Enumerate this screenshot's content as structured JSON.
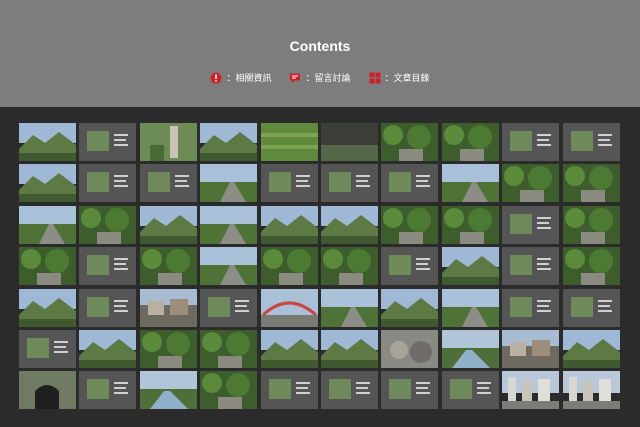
{
  "header": {
    "title": "Contents",
    "legend": [
      {
        "icon": "info-alert-icon",
        "label": "：相關資訊",
        "color": "#d11f26"
      },
      {
        "icon": "comment-icon",
        "label": "：留言討論",
        "color": "#d11f26"
      },
      {
        "icon": "grid-menu-icon",
        "label": "：文章目錄",
        "color": "#d11f26"
      }
    ]
  },
  "gallery": {
    "rows": 7,
    "cols": 10,
    "thumbs": [
      [
        "mountain",
        "doc",
        "tower",
        "mountain",
        "green",
        "dark",
        "forest",
        "forest",
        "doc",
        "doc"
      ],
      [
        "mountain",
        "doc",
        "doc",
        "road",
        "doc",
        "doc",
        "doc",
        "road",
        "forest",
        "forest"
      ],
      [
        "road",
        "forest",
        "mountain",
        "road",
        "mountain",
        "mountain",
        "forest",
        "forest",
        "doc",
        "forest"
      ],
      [
        "forest",
        "doc",
        "forest",
        "road",
        "forest",
        "forest",
        "doc",
        "mountain",
        "doc",
        "forest"
      ],
      [
        "mountain",
        "doc",
        "village",
        "doc",
        "bridge",
        "road",
        "mountain",
        "road",
        "doc",
        "doc"
      ],
      [
        "doc",
        "mountain",
        "forest",
        "forest",
        "mountain",
        "mountain",
        "rock",
        "river",
        "village",
        "mountain"
      ],
      [
        "tunnel",
        "doc",
        "river",
        "forest",
        "doc",
        "doc",
        "doc",
        "doc",
        "city",
        "city"
      ]
    ]
  }
}
